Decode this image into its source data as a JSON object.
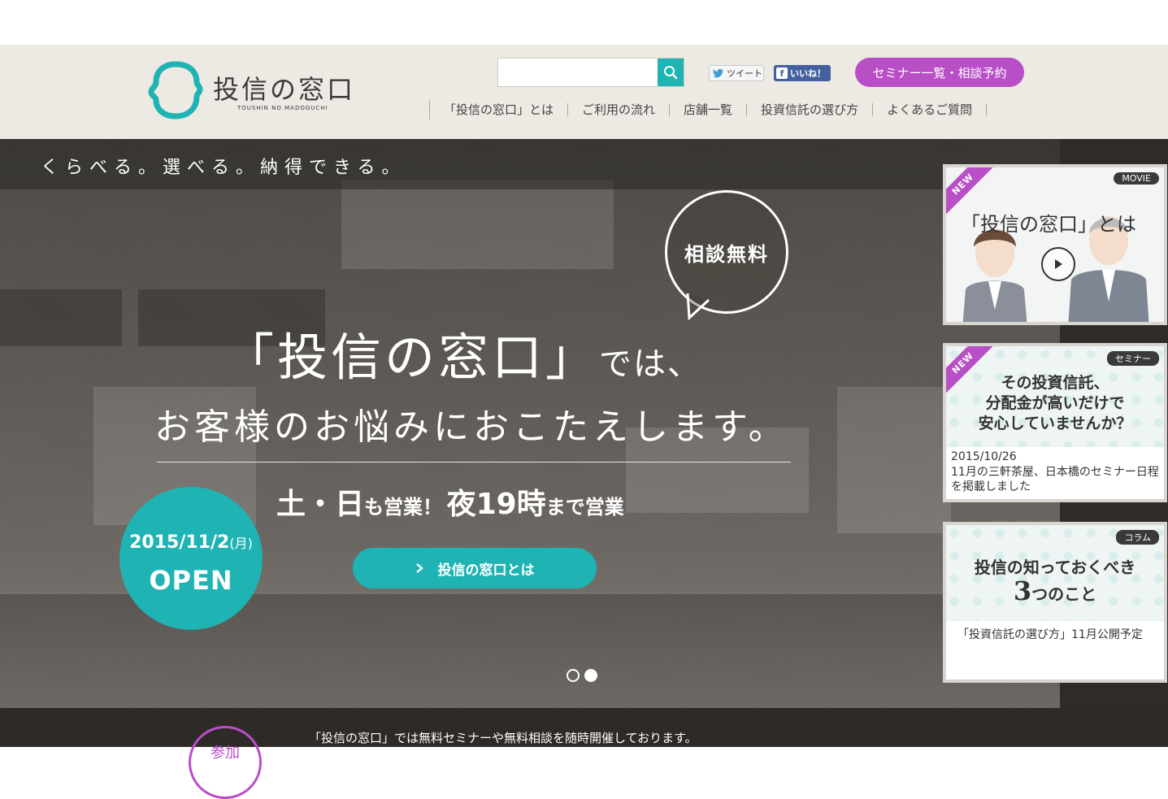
{
  "header": {
    "logo_text": "投信の窓口",
    "logo_sub": "TOUSHIN NO MADOGUCHI",
    "search_placeholder": "",
    "tweet_label": "ツイート",
    "like_label": "いいね！",
    "seminar_button": "セミナー一覧・相談予約",
    "nav": [
      {
        "label": "「投信の窓口」とは"
      },
      {
        "label": "ご利用の流れ"
      },
      {
        "label": "店舗一覧"
      },
      {
        "label": "投資信託の選び方"
      },
      {
        "label": "よくあるご質問"
      }
    ]
  },
  "hero": {
    "tagline": "くらべる。選べる。納得できる。",
    "bubble": "相談無料",
    "headline1_a": "「投信の窓口」",
    "headline1_b": "では、",
    "headline2": "お客様のお悩みにおこたえします。",
    "open_parts": [
      "土・日",
      "も営業！",
      "夜19時",
      "まで営業"
    ],
    "cta": "投信の窓口とは",
    "open_date": "2015/11/2",
    "open_dow": "(月)",
    "open_word": "OPEN",
    "dots": [
      {
        "active": false
      },
      {
        "active": true
      }
    ]
  },
  "cards": {
    "card1": {
      "ribbon": "NEW",
      "tag": "MOVIE",
      "title": "「投信の窓口」とは"
    },
    "card2": {
      "ribbon": "NEW",
      "tag": "セミナー",
      "headline": [
        "その投資信託、",
        "分配金が高いだけで",
        "安心していませんか？"
      ],
      "date": "2015/10/26",
      "text": "11月の三軒茶屋、日本橋のセミナー日程を掲載しました"
    },
    "card3": {
      "tag": "コラム",
      "headline_line1": "投信の知っておくべき",
      "headline_num": "3",
      "headline_line2": "つのこと",
      "text": "「投資信託の選び方」11月公開予定"
    }
  },
  "footer": {
    "circle_text": "参加",
    "text": "「投信の窓口」では無料セミナーや無料相談を随時開催しております。"
  },
  "colors": {
    "accent": "#1fb3b3",
    "purple": "#b94fc6",
    "header_bg": "#ede9e3"
  }
}
